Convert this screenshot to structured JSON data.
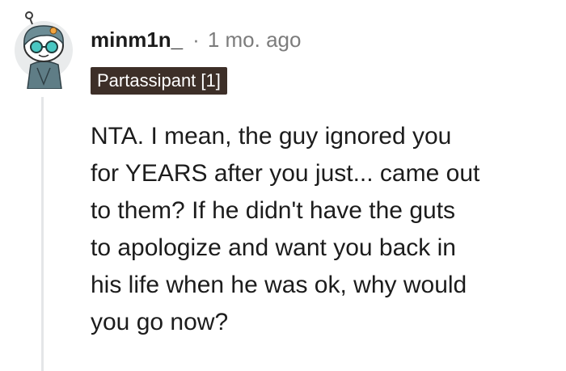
{
  "comment": {
    "username": "minm1n_",
    "separator": "·",
    "timestamp": "1 mo. ago",
    "flair": "Partassipant [1]",
    "body_lines": [
      "NTA. I mean, the guy ignored you",
      "for YEARS after you just... came out",
      "to them? If he didn't have the guts",
      "to apologize and want you back in",
      "his life when he was ok, why would",
      "you go now?"
    ]
  },
  "colors": {
    "flair_bg": "#3d2f28",
    "flair_text": "#ffffff",
    "meta_gray": "#7c7c7c",
    "thread_line": "#e4e6e8",
    "avatar_accent": "#49c7c2"
  },
  "icons": {
    "avatar": "snoo-avatar-icon"
  }
}
